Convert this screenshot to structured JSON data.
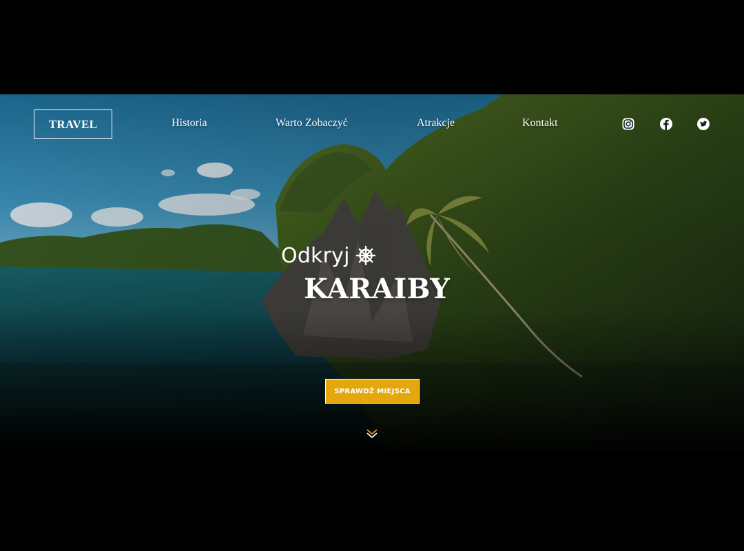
{
  "header": {
    "logo": "TRAVEL",
    "nav": {
      "historia": "Historia",
      "warto": "Warto Zobaczyć",
      "atrakcje": "Atrakcje",
      "kontakt": "Kontakt"
    },
    "social_icons": [
      "instagram-icon",
      "facebook-icon",
      "twitter-icon"
    ]
  },
  "hero": {
    "tagline": "Odkryj",
    "tagline_icon": "ship-wheel-icon",
    "headline": "KARAIBY",
    "cta_label": "SPRAWDŹ MIEJSCA",
    "scroll_icon": "double-chevron-down-icon"
  },
  "colors": {
    "accent": "#e5a70e",
    "text": "#ffffff",
    "background": "#000000"
  }
}
